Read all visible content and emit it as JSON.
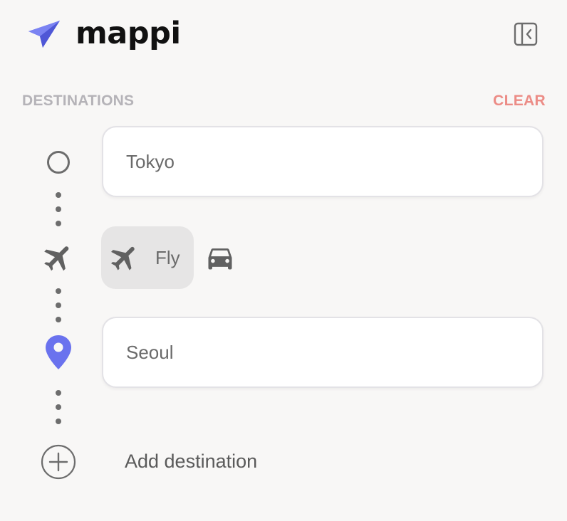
{
  "app": {
    "name": "mappi",
    "accent_color": "#6a72ee",
    "logo_icon": "paper-plane-icon"
  },
  "header": {
    "collapse_icon": "sidebar-collapse-icon"
  },
  "destinations": {
    "section_label": "DESTINATIONS",
    "clear_label": "CLEAR",
    "clear_color": "#ec8c86",
    "origin": {
      "value": "Tokyo",
      "icon": "circle-origin-icon"
    },
    "final": {
      "value": "Seoul",
      "icon": "map-pin-icon"
    },
    "add_label": "Add destination"
  },
  "transport": {
    "selected_mode": "fly",
    "modes": [
      {
        "id": "fly",
        "label": "Fly",
        "icon": "airplane-icon",
        "selected": true
      },
      {
        "id": "drive",
        "label": "",
        "icon": "car-icon",
        "selected": false
      }
    ]
  }
}
